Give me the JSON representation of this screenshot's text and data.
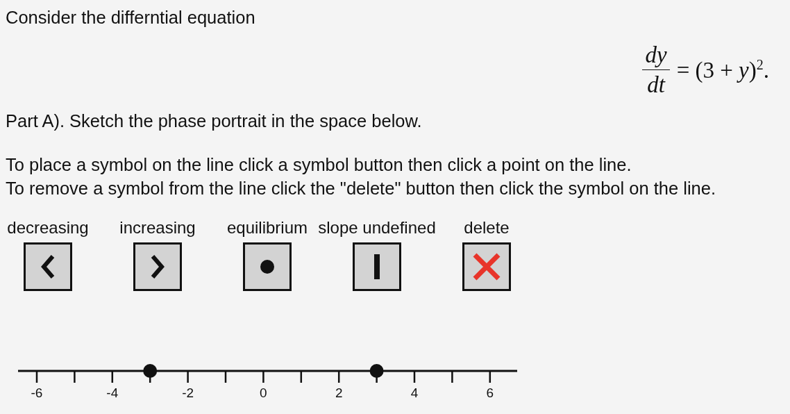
{
  "intro": "Consider the differntial equation",
  "equation": {
    "numerator": "dy",
    "denominator": "dt",
    "rhs": "= (3 + *y*)$^{2}$."
  },
  "part_a": "Part A). Sketch the phase portrait in the space below.",
  "instructions": [
    "To place a symbol on the line click a symbol button then click a point on the line.",
    "To remove a symbol from the line click the \"delete\" button then click the symbol on the line."
  ],
  "symbol_buttons": [
    {
      "label": "decreasing",
      "kind": "left"
    },
    {
      "label": "increasing",
      "kind": "right"
    },
    {
      "label": "equilibrium",
      "kind": "dot"
    },
    {
      "label": "slope undefined",
      "kind": "bar"
    },
    {
      "label": "delete",
      "kind": "delete"
    }
  ],
  "number_line": {
    "ticks": [
      {
        "label": "-6",
        "marked": false
      },
      {
        "marked": false
      },
      {
        "label": "-4",
        "marked": false
      },
      {
        "marked": true
      },
      {
        "label": "-2",
        "marked": false
      },
      {
        "marked": false
      },
      {
        "label": "0",
        "marked": false
      },
      {
        "marked": false
      },
      {
        "label": "2",
        "marked": false
      },
      {
        "marked": true
      },
      {
        "label": "4",
        "marked": false
      },
      {
        "marked": false
      },
      {
        "label": "6",
        "marked": false
      }
    ]
  }
}
